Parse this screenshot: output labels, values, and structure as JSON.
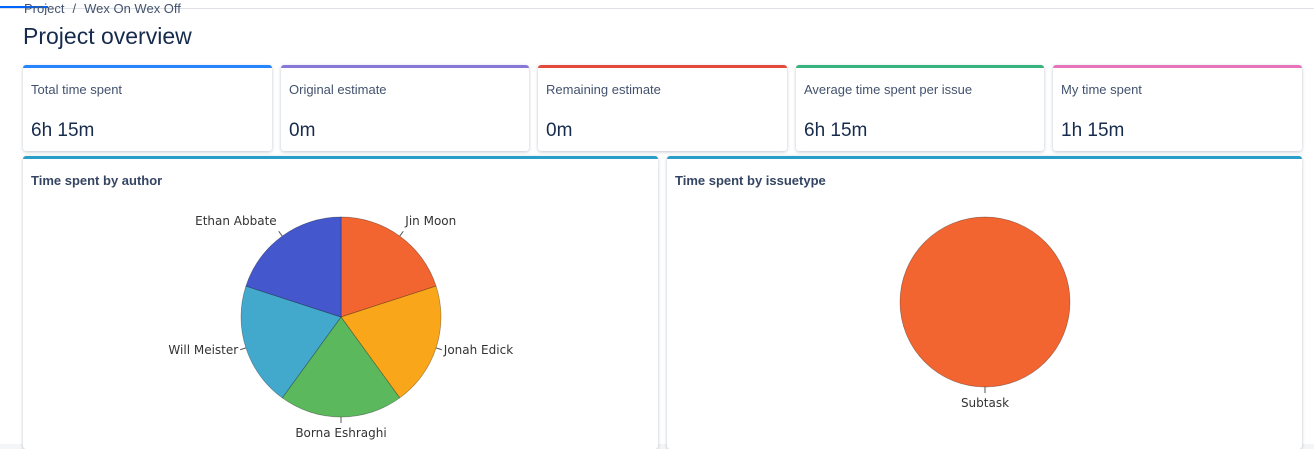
{
  "breadcrumb": {
    "root": "Project",
    "separator": "/",
    "current": "Wex On Wex Off"
  },
  "page_title": "Project overview",
  "stats": [
    {
      "label": "Total time spent",
      "value": "6h 15m",
      "color": "#2684ff"
    },
    {
      "label": "Original estimate",
      "value": "0m",
      "color": "#8777d9"
    },
    {
      "label": "Remaining estimate",
      "value": "0m",
      "color": "#e5493a"
    },
    {
      "label": "Average time spent per issue",
      "value": "6h 15m",
      "color": "#36b37e"
    },
    {
      "label": "My time spent",
      "value": "1h 15m",
      "color": "#e774bb"
    }
  ],
  "charts": {
    "by_author": {
      "title": "Time spent by author"
    },
    "by_issuetype": {
      "title": "Time spent by issuetype"
    }
  },
  "chart_data": [
    {
      "type": "pie",
      "title": "Time spent by author",
      "labels": [
        "Jin Moon",
        "Jonah Edick",
        "Borna Eshraghi",
        "Will Meister",
        "Ethan Abbate"
      ],
      "values": [
        1,
        1,
        1,
        1,
        1
      ],
      "colors": [
        "#f26430",
        "#faa61a",
        "#5cb85c",
        "#43a9cc",
        "#4457cc"
      ]
    },
    {
      "type": "pie",
      "title": "Time spent by issuetype",
      "labels": [
        "Subtask"
      ],
      "values": [
        1
      ],
      "colors": [
        "#f26430"
      ]
    }
  ]
}
